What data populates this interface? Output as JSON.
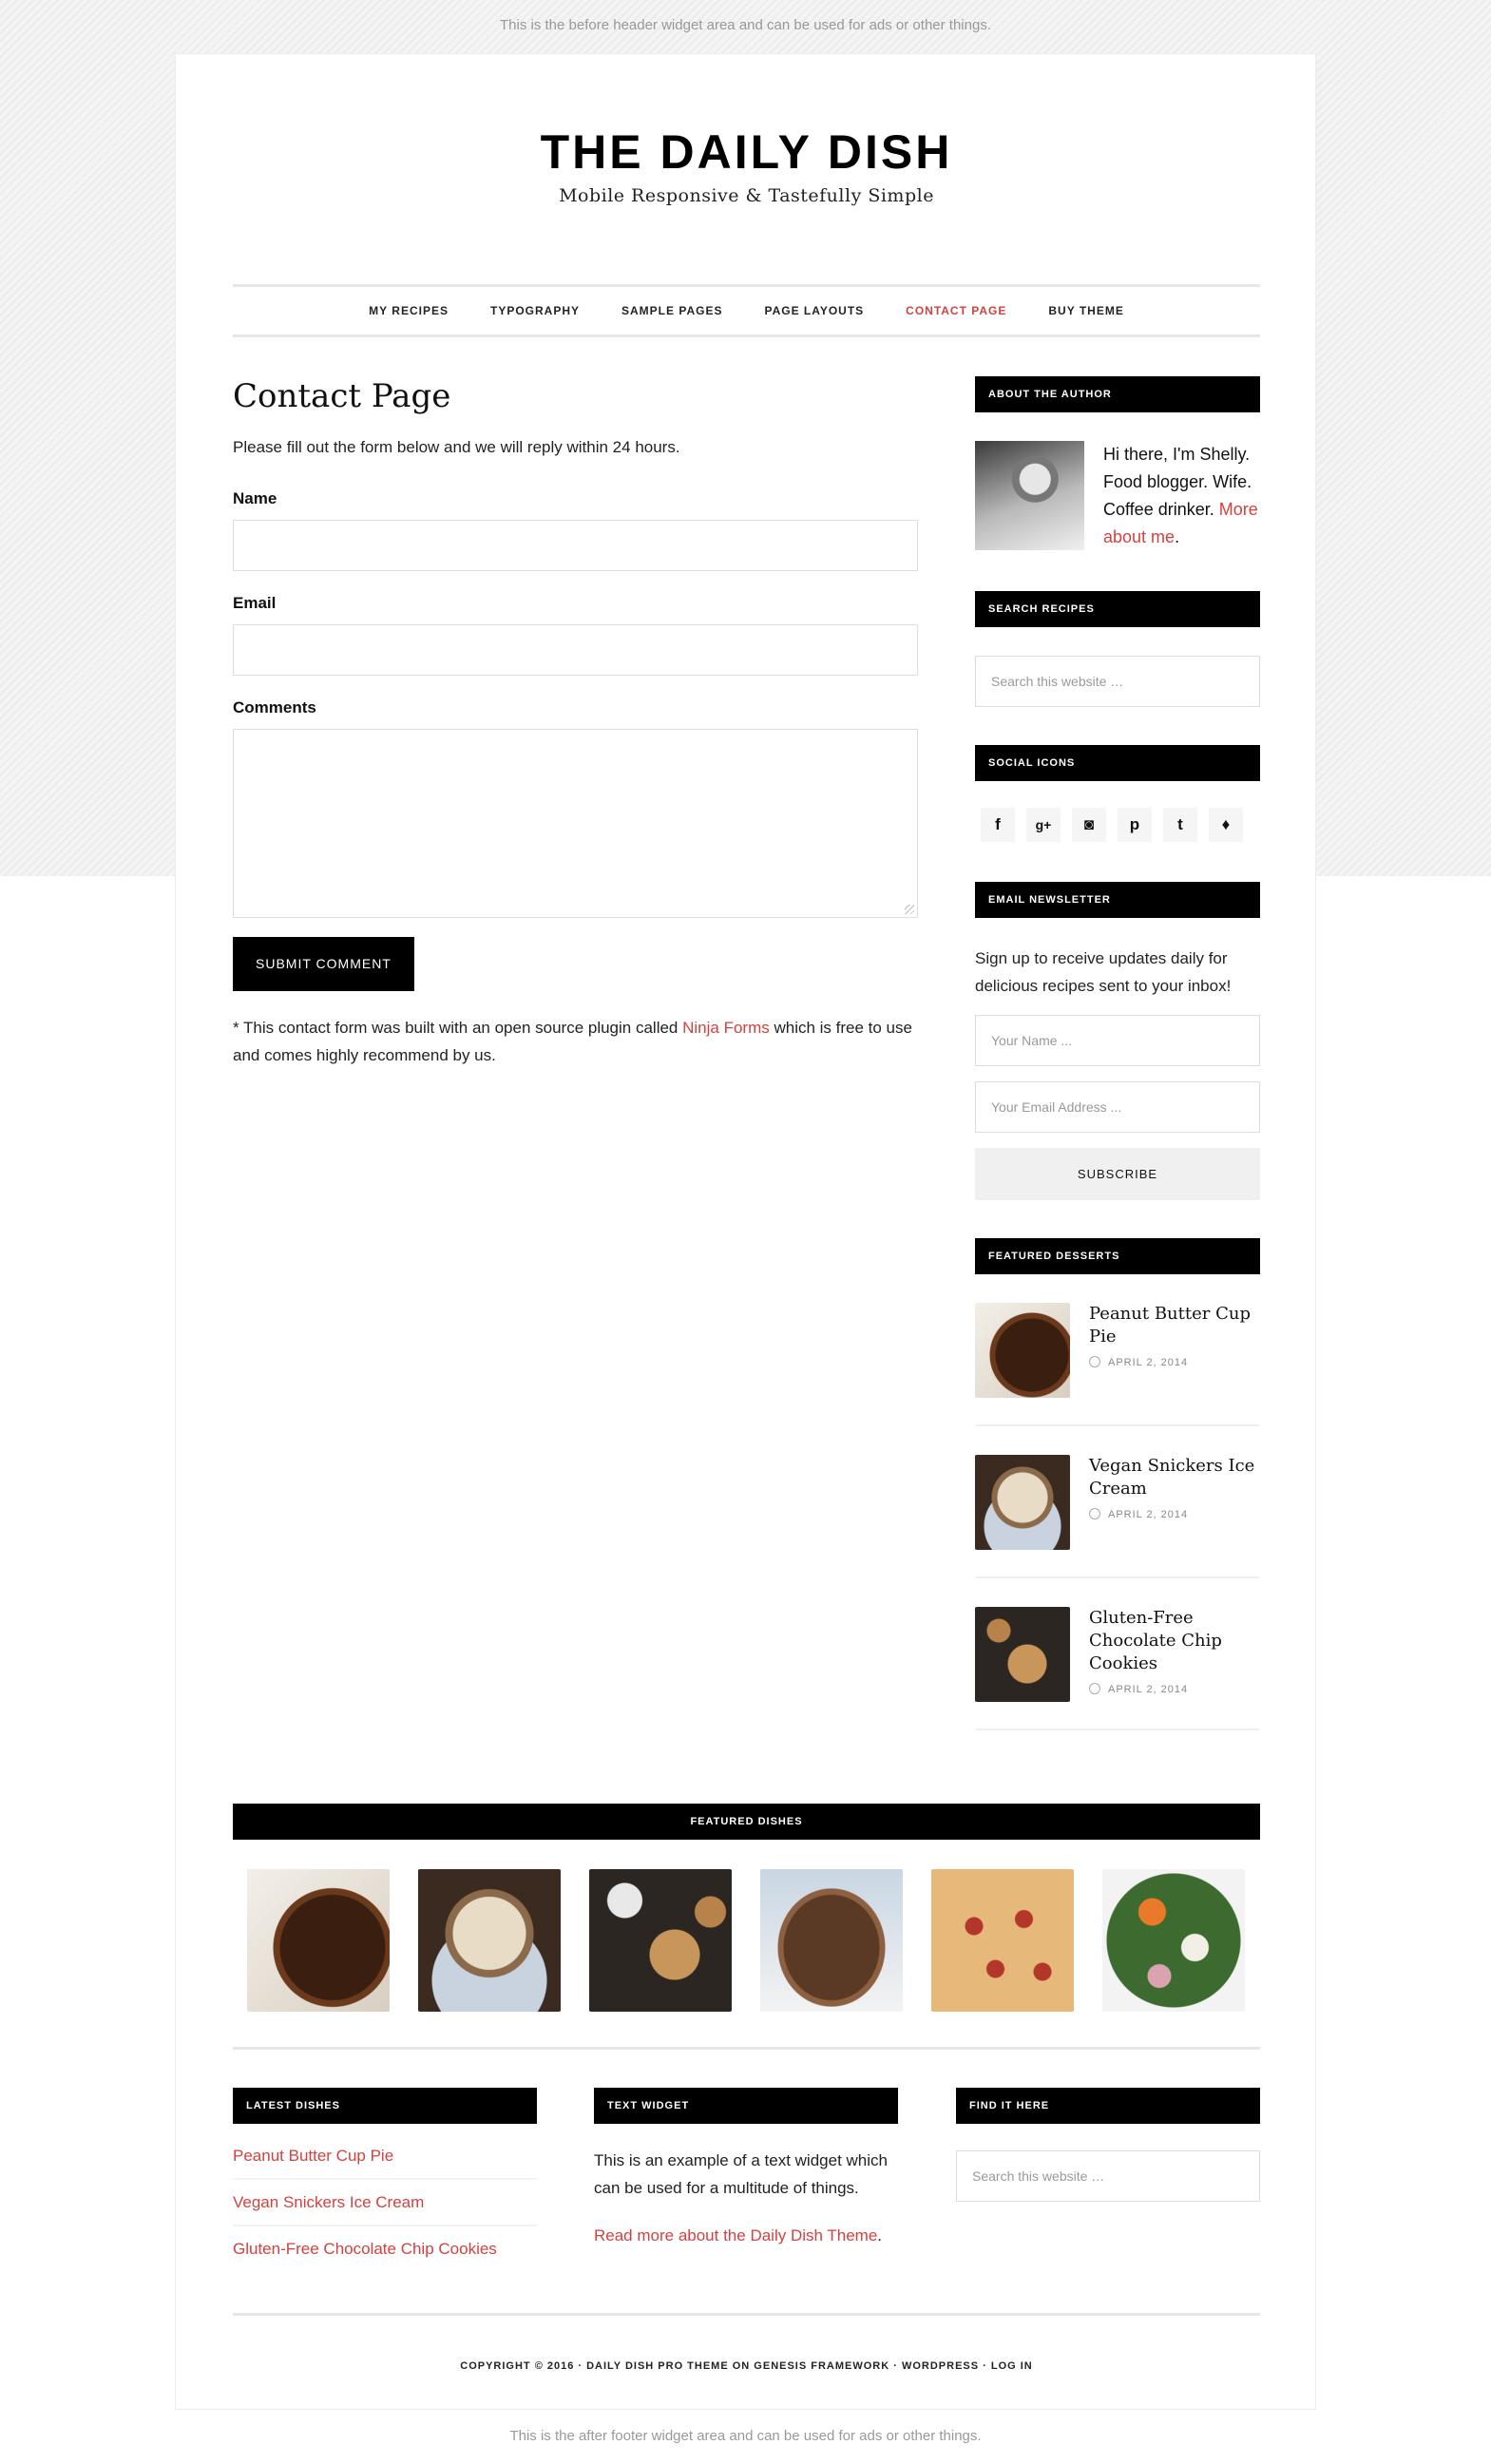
{
  "widgets": {
    "before_header": "This is the before header widget area and can be used for ads or other things.",
    "after_footer": "This is the after footer widget area and can be used for ads or other things."
  },
  "header": {
    "title": "THE DAILY DISH",
    "description": "Mobile Responsive & Tastefully Simple"
  },
  "nav": {
    "items": [
      "MY RECIPES",
      "TYPOGRAPHY",
      "SAMPLE PAGES",
      "PAGE LAYOUTS",
      "CONTACT PAGE",
      "BUY THEME"
    ],
    "active": "CONTACT PAGE"
  },
  "main": {
    "title": "Contact Page",
    "intro": "Please fill out the form below and we will reply within 24 hours.",
    "form": {
      "name_label": "Name",
      "email_label": "Email",
      "comments_label": "Comments",
      "submit_label": "SUBMIT COMMENT"
    },
    "note_before": "* This contact form was built with an open source plugin called ",
    "note_link": "Ninja Forms",
    "note_after": " which is free to use and comes highly recommend by us."
  },
  "sidebar": {
    "about": {
      "title": "ABOUT THE AUTHOR",
      "text": "Hi there, I'm Shelly. Food blogger. Wife. Coffee drinker.",
      "link": "More about me",
      "link_suffix": "."
    },
    "search": {
      "title": "SEARCH RECIPES",
      "placeholder": "Search this website …"
    },
    "social": {
      "title": "SOCIAL ICONS",
      "icons": [
        "facebook-icon",
        "google-plus-icon",
        "instagram-icon",
        "pinterest-icon",
        "tumblr-icon",
        "twitter-icon"
      ]
    },
    "newsletter": {
      "title": "EMAIL NEWSLETTER",
      "text": "Sign up to receive updates daily for delicious recipes sent to your inbox!",
      "name_placeholder": "Your Name ...",
      "email_placeholder": "Your Email Address ...",
      "button": "SUBSCRIBE"
    },
    "featured_desserts": {
      "title": "FEATURED DESSERTS",
      "items": [
        {
          "title": "Peanut Butter Cup Pie",
          "date": "APRIL 2, 2014"
        },
        {
          "title": "Vegan Snickers Ice Cream",
          "date": "APRIL 2, 2014"
        },
        {
          "title": "Gluten-Free Chocolate Chip Cookies",
          "date": "APRIL 2, 2014"
        }
      ]
    }
  },
  "featured_dishes": {
    "title": "FEATURED DISHES"
  },
  "footer_widgets": {
    "latest": {
      "title": "LATEST DISHES",
      "items": [
        "Peanut Butter Cup Pie",
        "Vegan Snickers Ice Cream",
        "Gluten-Free Chocolate Chip Cookies"
      ]
    },
    "text": {
      "title": "TEXT WIDGET",
      "body": "This is an example of a text widget which can be used for a multitude of things.",
      "link": "Read more about the Daily Dish Theme",
      "link_suffix": "."
    },
    "find": {
      "title": "FIND IT HERE",
      "placeholder": "Search this website …"
    }
  },
  "footer": {
    "copyright": "COPYRIGHT © 2016 · DAILY DISH PRO THEME ON GENESIS FRAMEWORK · WORDPRESS · LOG IN"
  },
  "colors": {
    "accent": "#d2423f",
    "dark": "#000000"
  }
}
